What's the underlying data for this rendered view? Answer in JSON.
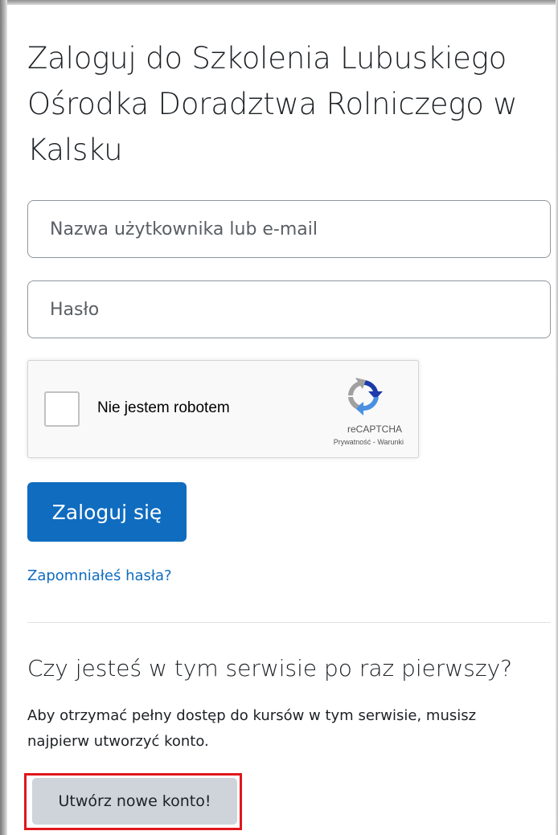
{
  "login": {
    "title": "Zaloguj do Szkolenia Lubuskiego Ośrodka Doradztwa Rolniczego w Kalsku",
    "username_placeholder": "Nazwa użytkownika lub e-mail",
    "username_value": "",
    "password_placeholder": "Hasło",
    "password_value": "",
    "login_button": "Zaloguj się",
    "forgot_link": "Zapomniałeś hasła?"
  },
  "recaptcha": {
    "label": "Nie jestem robotem",
    "brand": "reCAPTCHA",
    "privacy": "Prywatność",
    "separator": " - ",
    "terms": "Warunki",
    "checked": false
  },
  "signup": {
    "title": "Czy jesteś w tym serwisie po raz pierwszy?",
    "text": "Aby otrzymać pełny dostęp do kursów w tym serwisie, musisz najpierw utworzyć konto.",
    "button": "Utwórz nowe konto!"
  },
  "colors": {
    "primary": "#0f6cbf",
    "secondary_button": "#ced4da",
    "highlight": "#e1161c",
    "text": "#1d2125"
  }
}
